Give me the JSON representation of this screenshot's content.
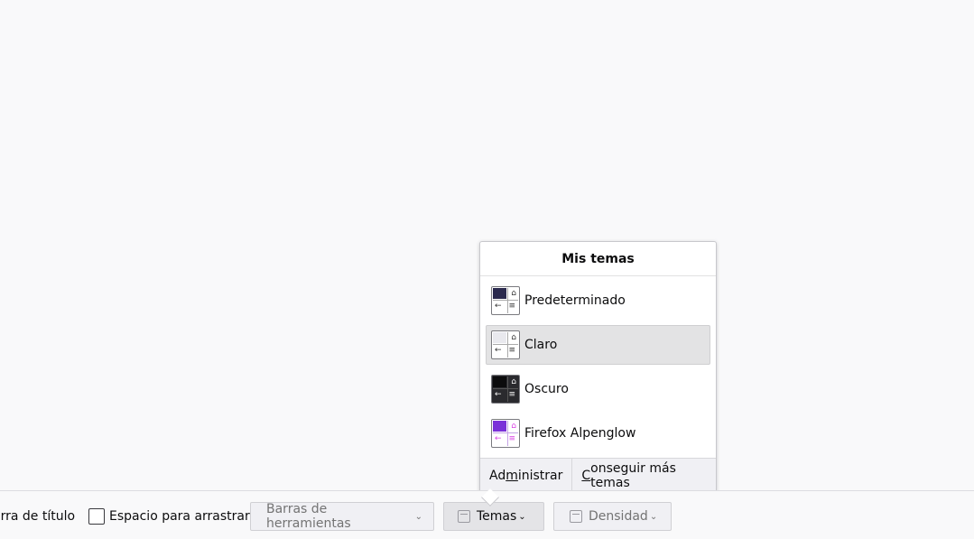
{
  "panel": {
    "title": "Mis temas",
    "themes": [
      {
        "name": "Predeterminado",
        "swatch": "#2b2a4e",
        "bg": "#ffffff",
        "fg": "#333333",
        "line": "#aaaaaa",
        "selected": false
      },
      {
        "name": "Claro",
        "swatch": "#e9e9ee",
        "bg": "#ffffff",
        "fg": "#333333",
        "line": "#aaaaaa",
        "selected": true
      },
      {
        "name": "Oscuro",
        "swatch": "#0c0c0d",
        "bg": "#2a2a2e",
        "fg": "#f9f9fa",
        "line": "#555555",
        "selected": false
      },
      {
        "name": "Firefox Alpenglow",
        "swatch": "#7a31d8",
        "bg": "#ffffff",
        "fg": "#d93fe3",
        "line": "#c4a3e6",
        "selected": false
      }
    ],
    "footer": {
      "manage_pre": "Ad",
      "manage_u": "m",
      "manage_post": "inistrar",
      "get_more_u": "C",
      "get_more_post": "onseguir más temas"
    }
  },
  "bottom_bar": {
    "titlebar_label": "arra de título",
    "drag_space_label": "Espacio para arrastrar",
    "toolbars_label": "Barras de herramientas",
    "themes_label": "Temas",
    "density_label": "Densidad"
  },
  "icons": {
    "home": "⌂",
    "back": "←",
    "menu": "≡",
    "chevron": "⌄"
  }
}
